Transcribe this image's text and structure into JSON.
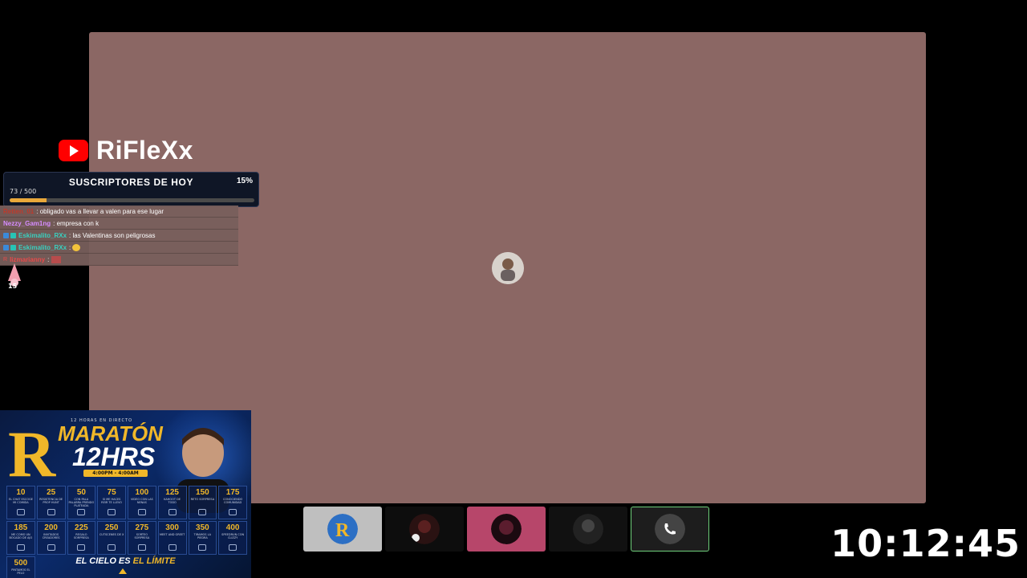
{
  "channel": {
    "name": "RiFleXx",
    "logo_icon": "youtube-icon",
    "brand_color": "#ff0000"
  },
  "subs_goal": {
    "title": "SUSCRIPTORES DE HOY",
    "current": 73,
    "goal": 500,
    "count_text": "73 / 500",
    "percent_text": "15%",
    "progress": 0.15
  },
  "chat": [
    {
      "user": "Retten_01",
      "user_color": "#c0392b",
      "message": "obligado vas a llevar a valen para ese lugar"
    },
    {
      "user": "Nezzy_Gam1ng",
      "user_color": "#d58cff",
      "message": "empresa con k"
    },
    {
      "user": "Eskimalito_RXx",
      "user_color": "#39d0c0",
      "message": "las Valentinas son peligrosas"
    },
    {
      "user": "Eskimalito_RXx",
      "user_color": "#39d0c0",
      "message": "",
      "emote": "smile-emote"
    },
    {
      "user": "lizmarianny",
      "user_color": "#e84a4a",
      "message": "",
      "emote": "image-emote"
    }
  ],
  "sticker_count": "15",
  "poster": {
    "top_text": "12 HORAS EN DIRECTO",
    "logo_letter": "R",
    "title1": "MARATÓN",
    "title2": "12HRS",
    "time": "4:00PM - 4:00AM",
    "footer_a": "EL CIELO ES",
    "footer_b": "EL LÍMITE",
    "goals": [
      {
        "value": "10",
        "text": "EL CHAT ESCOGE MI COMIDA"
      },
      {
        "value": "25",
        "text": "RESISTENCIA DE PROP HUNT"
      },
      {
        "value": "50",
        "text": "CON PALA PALABRA PRENDO PLATEADA"
      },
      {
        "value": "75",
        "text": "SI ME HACES REIR TE LLEVO"
      },
      {
        "value": "100",
        "text": "VIDEO CON LAS NENAS"
      },
      {
        "value": "125",
        "text": "KAHOOT DE TODO"
      },
      {
        "value": "150",
        "text": "RETO SORPRESA"
      },
      {
        "value": "175",
        "text": "CONOCIENDO COMUNIDAD"
      },
      {
        "value": "185",
        "text": "ME COMO UN BOCADO DE AJO"
      },
      {
        "value": "200",
        "text": "INVITADOS CREADORES"
      },
      {
        "value": "225",
        "text": "REGALO SORPRESA"
      },
      {
        "value": "250",
        "text": "CUTSCENES DE X"
      },
      {
        "value": "275",
        "text": "SORTEO SORPRESA"
      },
      {
        "value": "300",
        "text": "MEET AND GREET"
      },
      {
        "value": "350",
        "text": "TIRAMOS LA PIEDRA"
      },
      {
        "value": "400",
        "text": "SPEEDRUN CON CLIZZY"
      },
      {
        "value": "500",
        "text": "PINTAMOS EL PELO"
      }
    ]
  },
  "participants": [
    {
      "id": "tile-1",
      "avatar_color": "#2c6fc4"
    },
    {
      "id": "tile-2",
      "avatar_color": "#4a1a1a"
    },
    {
      "id": "tile-3",
      "avatar_color": "#2a0f18"
    },
    {
      "id": "tile-4",
      "avatar_color": "#3a3a3a"
    },
    {
      "id": "tile-5",
      "avatar_color": "#444"
    }
  ],
  "clock": "10:12:45",
  "colors": {
    "main_video_bg": "#8b6764",
    "accent_gold": "#f0b729",
    "active_tile_border": "#6ecf7a"
  }
}
